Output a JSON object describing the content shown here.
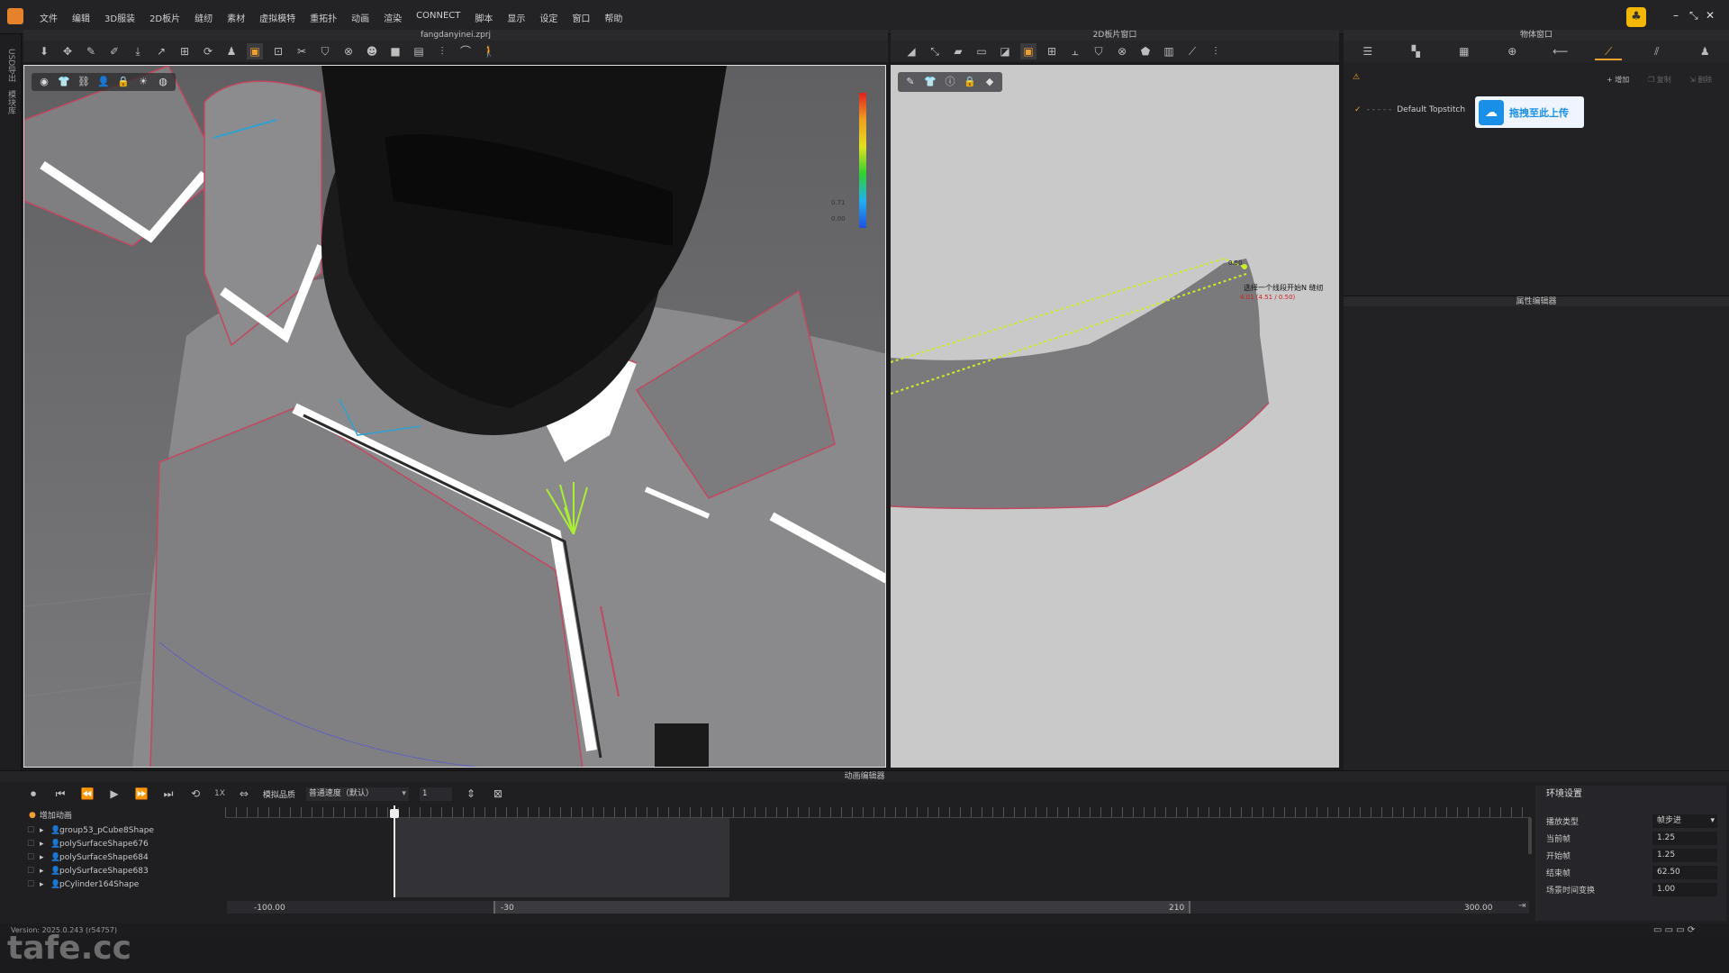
{
  "menu": [
    "文件",
    "编辑",
    "3D服装",
    "2D板片",
    "缝纫",
    "素材",
    "虚拟模特",
    "重拓扑",
    "动画",
    "渲染",
    "CONNECT",
    "脚本",
    "显示",
    "设定",
    "窗口",
    "帮助"
  ],
  "left_strip": {
    "tab1": "USD导出",
    "tab2": "模块库"
  },
  "view3d": {
    "title": "fangdanyinei.zprj",
    "colorbar_label_mid": "0.71",
    "colorbar_label_low": "0.00"
  },
  "view2d": {
    "title": "2D板片窗口",
    "point_label": "0.50",
    "hint_text": "选择一个线段开始N 缝纫",
    "hint_value": "4.01 (4.51 / 0.50)"
  },
  "object_window": {
    "title": "物体窗口",
    "add_label": "增加",
    "copy_label": "复制",
    "delete_label": "删除",
    "item_label": "Default Topstitch",
    "upload_label": "拖拽至此上传"
  },
  "property_editor": {
    "title": "属性编辑器"
  },
  "anim": {
    "title": "动画编辑器",
    "quality_label": "模拟品质",
    "speed_value": "普通速度（默认）",
    "frame_input": "1",
    "speed_1x": "1X",
    "add_anim": "增加动画",
    "tree_items": [
      "group53_pCube8Shape",
      "polySurfaceShape676",
      "polySurfaceShape684",
      "polySurfaceShape683",
      "pCylinder164Shape"
    ],
    "range_start": "-100.00",
    "range_mid_low": "-30",
    "range_mid_high": "210",
    "range_end": "300.00"
  },
  "env": {
    "title": "环境设置",
    "rows": [
      {
        "label": "播放类型",
        "value": "帧步进"
      },
      {
        "label": "当前帧",
        "value": "1.25"
      },
      {
        "label": "开始帧",
        "value": "1.25"
      },
      {
        "label": "结束帧",
        "value": "62.50"
      },
      {
        "label": "场景时间变换",
        "value": "1.00"
      }
    ]
  },
  "status": {
    "version": "Version: 2025.0.243 (r54757)"
  },
  "watermark": "tafe.cc",
  "colors": {
    "accent": "#f0a030",
    "upload_blue": "#1a8fe8",
    "seam_green": "#c8f028"
  }
}
